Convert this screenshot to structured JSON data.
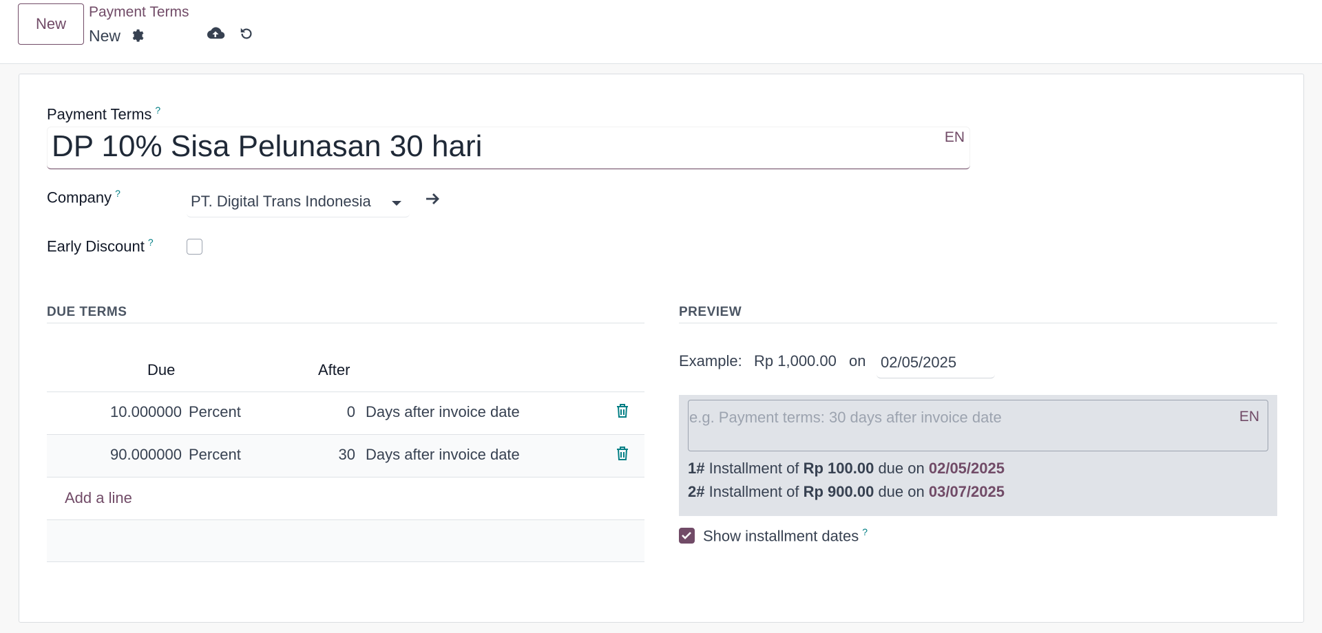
{
  "header": {
    "new_button": "New",
    "breadcrumb": "Payment Terms",
    "record": "New"
  },
  "form": {
    "payment_terms_label": "Payment Terms",
    "help": "?",
    "name_value": "DP 10% Sisa Pelunasan 30 hari",
    "lang": "EN",
    "company_label": "Company",
    "company_value": "PT. Digital Trans Indonesia",
    "early_discount_label": "Early Discount",
    "early_discount_checked": false
  },
  "due_terms": {
    "title": "DUE TERMS",
    "columns": {
      "due": "Due",
      "after": "After"
    },
    "rows": [
      {
        "due": "10.000000",
        "unit": "Percent",
        "after": "0",
        "type": "Days after invoice date"
      },
      {
        "due": "90.000000",
        "unit": "Percent",
        "after": "30",
        "type": "Days after invoice date"
      }
    ],
    "add_line": "Add a line"
  },
  "preview": {
    "title": "PREVIEW",
    "example_label": "Example:",
    "example_amount": "Rp 1,000.00",
    "on": "on",
    "date": "02/05/2025",
    "note_placeholder": "e.g. Payment terms: 30 days after invoice date",
    "lang": "EN",
    "installments": [
      {
        "num": "1#",
        "text": "Installment of",
        "amount": "Rp 100.00",
        "due_on": "due on",
        "date": "02/05/2025"
      },
      {
        "num": "2#",
        "text": "Installment of",
        "amount": "Rp 900.00",
        "due_on": "due on",
        "date": "03/07/2025"
      }
    ],
    "show_dates_label": "Show installment dates",
    "show_dates_checked": true
  },
  "colors": {
    "primary": "#714b67",
    "help": "#017e84",
    "trash": "#017e84"
  }
}
